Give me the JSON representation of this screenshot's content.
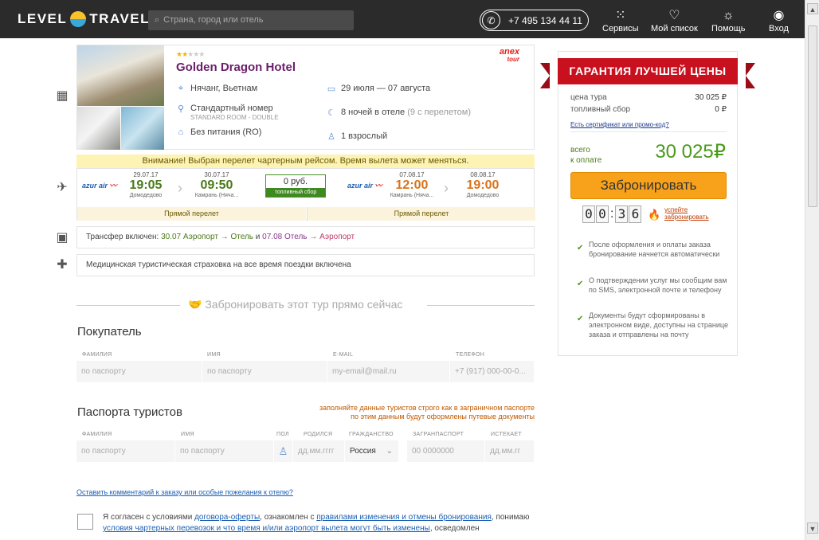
{
  "header": {
    "logo_left": "LEVEL",
    "logo_right": "TRAVEL",
    "search_placeholder": "Страна, город или отель",
    "phone": "+7 495 134 44 11",
    "nav": [
      {
        "label": "Сервисы",
        "icon": "grid-icon"
      },
      {
        "label": "Мой список",
        "icon": "heart-icon"
      },
      {
        "label": "Помощь",
        "icon": "bulb-icon"
      },
      {
        "label": "Вход",
        "icon": "user-icon"
      }
    ]
  },
  "hotel": {
    "stars": 2,
    "name": "Golden Dragon Hotel",
    "operator": "anex tour",
    "location": "Нячанг, Вьетнам",
    "room": "Стандартный номер",
    "room_sub": "STANDARD ROOM - DOUBLE",
    "meal": "Без питания (RO)",
    "dates": "29 июля — 07 августа",
    "nights": "8 ночей в отеле",
    "nights_note": "(9 с перелетом)",
    "tourists": "1 взрослый"
  },
  "warning": "Внимание! Выбран перелет чартерным рейсом. Время вылета может меняться.",
  "flight": {
    "airline": "azur air",
    "out": {
      "dep_date": "29.07.17",
      "dep_time": "19:05",
      "dep_place": "Домодедово",
      "arr_date": "30.07.17",
      "arr_time": "09:50",
      "arr_place": "Камрань (Нячa..."
    },
    "fuel_value": "0 руб.",
    "fuel_label": "топливный сбор",
    "back": {
      "dep_date": "07.08.17",
      "dep_time": "12:00",
      "dep_place": "Камрань (Нячa...",
      "arr_date": "08.08.17",
      "arr_time": "19:00",
      "arr_place": "Домодедово"
    },
    "direct_label": "Прямой перелет"
  },
  "transfer": {
    "prefix": "Трансфер включен:",
    "d1": "30.07",
    "r1a": "Аэропорт",
    "r1b": "Отель",
    "and": "и",
    "d2": "07.08",
    "r2a": "Отель",
    "r2b": "Аэропорт",
    "arrow": "→"
  },
  "insurance": "Медицинская туристическая страховка на все время поездки включена",
  "book_now": "Забронировать этот тур прямо сейчас",
  "buyer": {
    "title": "Покупатель",
    "headers": [
      "фамилия",
      "имя",
      "e-mail",
      "телефон"
    ],
    "placeholders": [
      "по паспорту",
      "по паспорту",
      "my-email@mail.ru",
      "+7 (917) 000-00-0..."
    ]
  },
  "passports": {
    "title": "Паспорта туристов",
    "note_line1": "заполняйте данные туристов строго как в заграничном паспорте",
    "note_line2": "по этим данным будут оформлены путевые документы",
    "headers": [
      "фамилия",
      "имя",
      "пол",
      "родился",
      "гражданство",
      "загранпаспорт",
      "истекает"
    ],
    "values": [
      "по паспорту",
      "по паспорту",
      "",
      "дд.мм.гггг",
      "Россия",
      "00 0000000",
      "дд.мм.гг"
    ]
  },
  "comment_link": "Оставить комментарий к заказу или особые пожелания к отелю?",
  "agree": {
    "t1": "Я согласен с условиями ",
    "l1": "договора-оферты",
    "t2": ", ознакомлен с ",
    "l2": "правилами изменения и отмены бронирования",
    "t3": ", понимаю ",
    "l3": "условия чартерных перевозок и что время и/или аэропорт вылета могут быть изменены",
    "t4": ", осведомлен"
  },
  "right": {
    "banner": "ГАРАНТИЯ ЛУЧШЕЙ ЦЕНЫ",
    "price_label": "цена тура",
    "price_value": "30 025 ₽",
    "fuel_label": "топливный сбор",
    "fuel_value": "0 ₽",
    "promo": "Есть сертификат или промо-код?",
    "total_l1": "всего",
    "total_l2": "к оплате",
    "total_value": "30 025₽",
    "book": "Забронировать",
    "timer": [
      "0",
      "0",
      "3",
      "6"
    ],
    "hurry_l1": "успейте",
    "hurry_l2": "забронировать",
    "checks": [
      "После оформления и оплаты заказа бронирование начнется автоматически",
      "О подтверждении услуг мы сообщим вам по SMS, электронной почте и телефону",
      "Документы будут сформированы в электронном виде, доступны на странице заказа и отправлены на почту"
    ]
  },
  "colors": {
    "topbar": "#2b2b2b",
    "hotel_name": "#6b1e6b",
    "price_green": "#4a9a1a",
    "book_orange": "#f7a21a",
    "banner_red": "#c8101e"
  }
}
